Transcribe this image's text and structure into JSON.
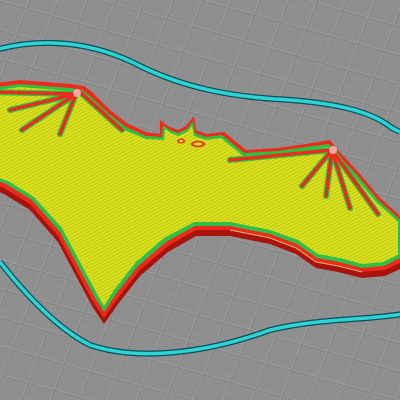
{
  "scene": {
    "view": "slicer-layer-preview",
    "object": "bat",
    "colors": {
      "plate": "#8f8f8f",
      "grid_line": "#a6a6a6",
      "grid_line_dark": "#7d7d7d",
      "skirt": "#2fd3d3",
      "skirt_edge": "#0b4f59",
      "perimeter": "#ee2a1d",
      "perimeter_dark": "#a8130c",
      "inner_wall": "#2fbf46",
      "infill": "#d8df1e",
      "infill_line": "#9ea600",
      "support_edge": "#e8f5a0"
    }
  }
}
